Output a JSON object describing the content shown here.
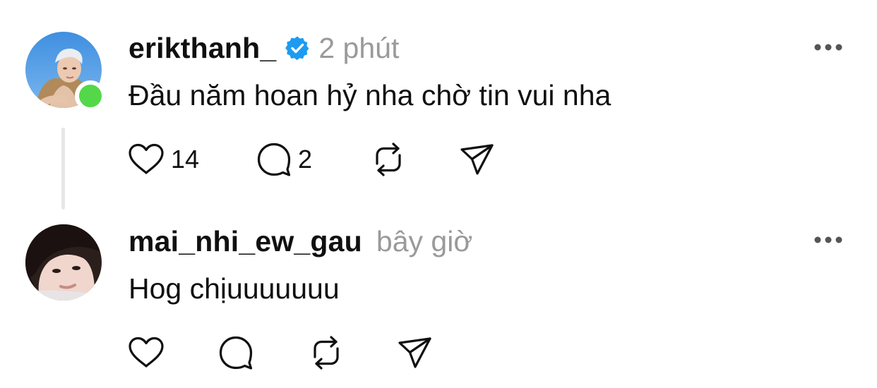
{
  "comments": [
    {
      "username": "erikthanh_",
      "verified": true,
      "time": "2 phút",
      "text": "Đầu năm hoan hỷ nha chờ tin vui nha",
      "online": true,
      "actions": {
        "like_count": "14",
        "reply_count": "2"
      }
    },
    {
      "username": "mai_nhi_ew_gau",
      "verified": false,
      "time": "bây giờ",
      "text": "Hog chịuuuuuuu",
      "online": false,
      "actions": {
        "like_count": "",
        "reply_count": ""
      }
    }
  ],
  "colors": {
    "verified_badge": "#1d9bf0",
    "online_dot": "#54d84a",
    "secondary_text": "#9a9a9a"
  },
  "icons": [
    "heart-icon",
    "comment-icon",
    "repost-icon",
    "share-icon",
    "more-icon",
    "verified-badge-icon"
  ]
}
